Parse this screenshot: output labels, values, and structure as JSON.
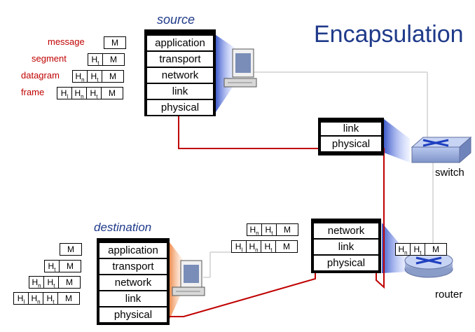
{
  "title": "Encapsulation",
  "source_label": "source",
  "destination_label": "destination",
  "switch_label": "switch",
  "router_label": "router",
  "layers": {
    "application": "application",
    "transport": "transport",
    "network": "network",
    "link": "link",
    "physical": "physical"
  },
  "pdu_labels": {
    "message": "message",
    "segment": "segment",
    "datagram": "datagram",
    "frame": "frame"
  },
  "header_text": {
    "M": "M",
    "H": "H",
    "t": "t",
    "n": "n",
    "l": "l"
  },
  "colors": {
    "title": "#1f3a8a",
    "pdu_label": "#c00000",
    "path_line": "#c00000",
    "connection_line": "#d0d0d0",
    "stack_border": "#000000"
  }
}
